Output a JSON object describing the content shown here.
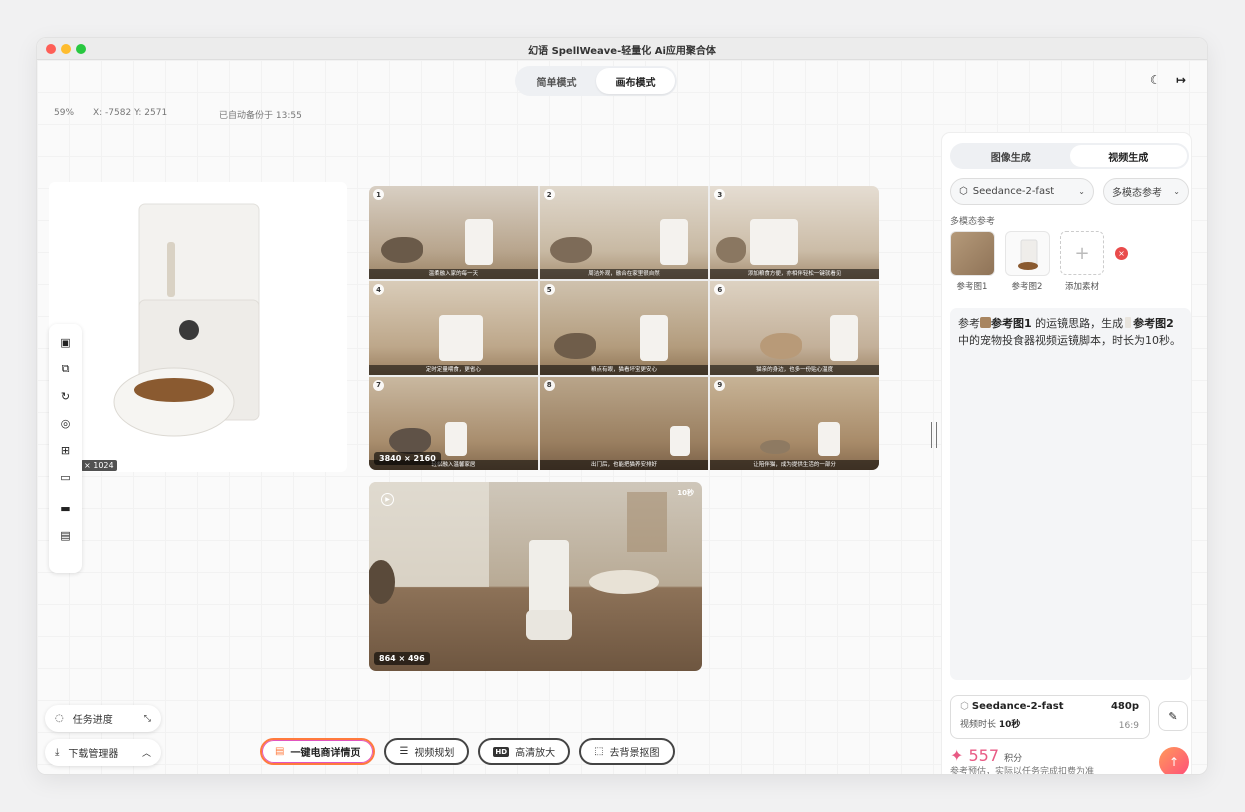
{
  "window": {
    "title": "幻语 SpellWeave-轻量化 Ai应用聚合体"
  },
  "modes": [
    {
      "label": "简单模式",
      "active": false
    },
    {
      "label": "画布模式",
      "active": true
    }
  ],
  "status": {
    "zoom": "59%",
    "coords": "X: -7582  Y: 2571",
    "autosave": "已自动备份于 13:55"
  },
  "product": {
    "size_label": "× 1024"
  },
  "grid": {
    "size_label": "3840 × 2160",
    "cells": [
      {
        "num": "1",
        "caption": "温柔融入家的每一天"
      },
      {
        "num": "2",
        "caption": "周洁外观，融合在家里很自然"
      },
      {
        "num": "3",
        "caption": "添加粮食方便，亦相伴轻松一键就看见"
      },
      {
        "num": "4",
        "caption": "定时定量喂食，更省心"
      },
      {
        "num": "5",
        "caption": "粮点有眼，猫看坏宝更安心"
      },
      {
        "num": "6",
        "caption": "猫亲的身边，也多一份贴心温度"
      },
      {
        "num": "7",
        "caption": "轻松融入温馨家居"
      },
      {
        "num": "8",
        "caption": "出门后，也能把猫养安排好"
      },
      {
        "num": "9",
        "caption": "让陪伴猫，成为提供生活的一部分"
      }
    ]
  },
  "video": {
    "size_label": "864 × 496",
    "duration": "10秒"
  },
  "panel": {
    "tabs": [
      {
        "label": "图像生成",
        "active": false
      },
      {
        "label": "视频生成",
        "active": true
      }
    ],
    "model_select": "Seedance-2-fast",
    "ref_select": "多模态参考",
    "section_label": "多模态参考",
    "refs": [
      {
        "label": "参考图1"
      },
      {
        "label": "参考图2"
      }
    ],
    "add_label": "添加素材",
    "prompt": {
      "p1": "参考",
      "ref1": "参考图1",
      "p2": " 的运镜思路，生成",
      "ref2": "参考图2",
      "p3": " 中的宠物投食器视频运镜脚本，时长为10秒。"
    },
    "info": {
      "model": "Seedance-2-fast",
      "resolution": "480p",
      "duration_label": "视频时长",
      "duration": "10秒",
      "ratio": "16:9"
    },
    "credits": {
      "amount": "557",
      "unit": "积分",
      "note": "参考预估，实际以任务完成扣费为准"
    }
  },
  "actions": [
    {
      "label": "一键电商详情页",
      "icon": "document-icon"
    },
    {
      "label": "视频规划",
      "icon": "list-icon"
    },
    {
      "label": "高清放大",
      "icon": "hd-icon"
    },
    {
      "label": "去背景抠图",
      "icon": "cutout-icon"
    }
  ],
  "bottom_left": {
    "task": "任务进度",
    "download": "下载管理器"
  },
  "colors": {
    "accent": "#ff7a3d",
    "credit": "#e85a84",
    "danger": "#e94b4b"
  }
}
